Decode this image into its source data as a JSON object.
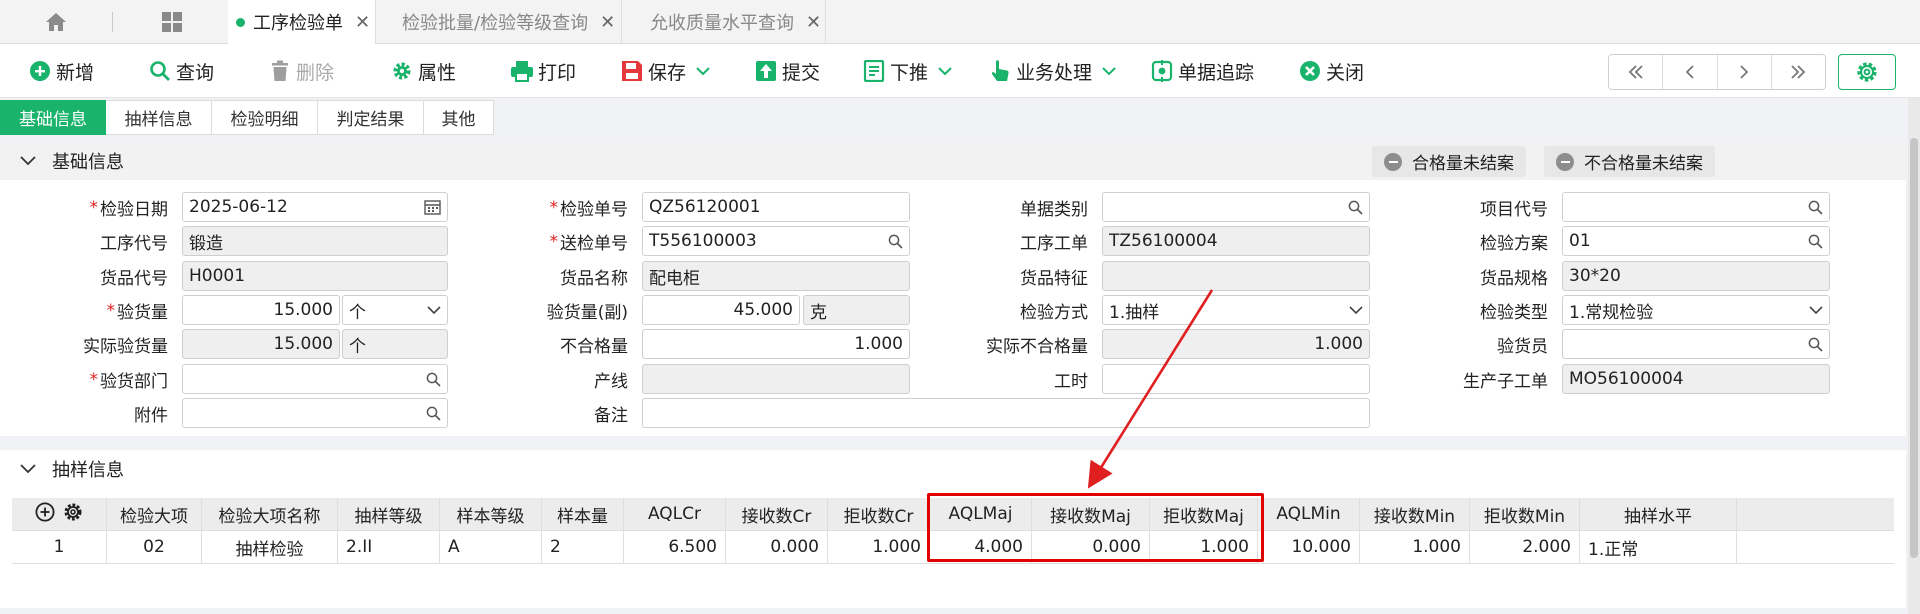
{
  "colors": {
    "accent": "#19b36b",
    "danger": "#e02020",
    "delete_icon": "#9e9e9e"
  },
  "window_tabs": [
    {
      "label": "工序检验单",
      "active": true
    },
    {
      "label": "检验批量/检验等级查询",
      "active": false
    },
    {
      "label": "允收质量水平查询",
      "active": false
    }
  ],
  "toolbar": {
    "new": "新增",
    "query": "查询",
    "delete": "删除",
    "properties": "属性",
    "print": "打印",
    "save": "保存",
    "submit": "提交",
    "push_down": "下推",
    "business": "业务处理",
    "trace": "单据追踪",
    "close": "关闭"
  },
  "subtabs": [
    "基础信息",
    "抽样信息",
    "检验明细",
    "判定结果",
    "其他"
  ],
  "basic": {
    "title": "基础信息",
    "pill_ok": "合格量未结案",
    "pill_ng": "不合格量未结案",
    "labels": {
      "inspect_date": "检验日期",
      "process_code": "工序代号",
      "goods_code": "货品代号",
      "qty": "验货量",
      "actual_qty": "实际验货量",
      "dept": "验货部门",
      "attach": "附件",
      "inspect_no": "检验单号",
      "send_no": "送检单号",
      "goods_name": "货品名称",
      "qty_sub": "验货量(副)",
      "ng_qty": "不合格量",
      "line": "产线",
      "remark": "备注",
      "doc_type": "单据类别",
      "process_order": "工序工单",
      "goods_feature": "货品特征",
      "method": "检验方式",
      "actual_ng": "实际不合格量",
      "work_hours": "工时",
      "project_code": "项目代号",
      "scheme": "检验方案",
      "spec": "货品规格",
      "type": "检验类型",
      "inspector": "验货员",
      "sub_mo": "生产子工单"
    },
    "values": {
      "inspect_date": "2025-06-12",
      "process_code": "锻造",
      "goods_code": "H0001",
      "qty": "15.000",
      "qty_unit": "个",
      "actual_qty": "15.000",
      "actual_unit": "个",
      "dept": "",
      "attach": "",
      "inspect_no": "QZ56120001",
      "send_no": "T556100003",
      "goods_name": "配电柜",
      "qty_sub": "45.000",
      "qty_sub_unit": "克",
      "ng_qty": "1.000",
      "line": "",
      "remark": "",
      "doc_type": "",
      "process_order": "TZ56100004",
      "goods_feature": "",
      "method": "1.抽样",
      "actual_ng": "1.000",
      "work_hours": "",
      "project_code": "",
      "scheme": "01",
      "spec": "30*20",
      "type": "1.常规检验",
      "inspector": "",
      "sub_mo": "MO56100004"
    }
  },
  "sampling": {
    "title": "抽样信息",
    "columns": [
      "检验大项",
      "检验大项名称",
      "抽样等级",
      "样本等级",
      "样本量",
      "AQLCr",
      "接收数Cr",
      "拒收数Cr",
      "AQLMaj",
      "接收数Maj",
      "拒收数Maj",
      "AQLMin",
      "接收数Min",
      "拒收数Min",
      "抽样水平"
    ],
    "rows": [
      {
        "no": "1",
        "cells": [
          "02",
          "抽样检验",
          "2.II",
          "A",
          "2",
          "6.500",
          "0.000",
          "1.000",
          "4.000",
          "0.000",
          "1.000",
          "10.000",
          "1.000",
          "2.000",
          "1.正常"
        ]
      }
    ]
  }
}
